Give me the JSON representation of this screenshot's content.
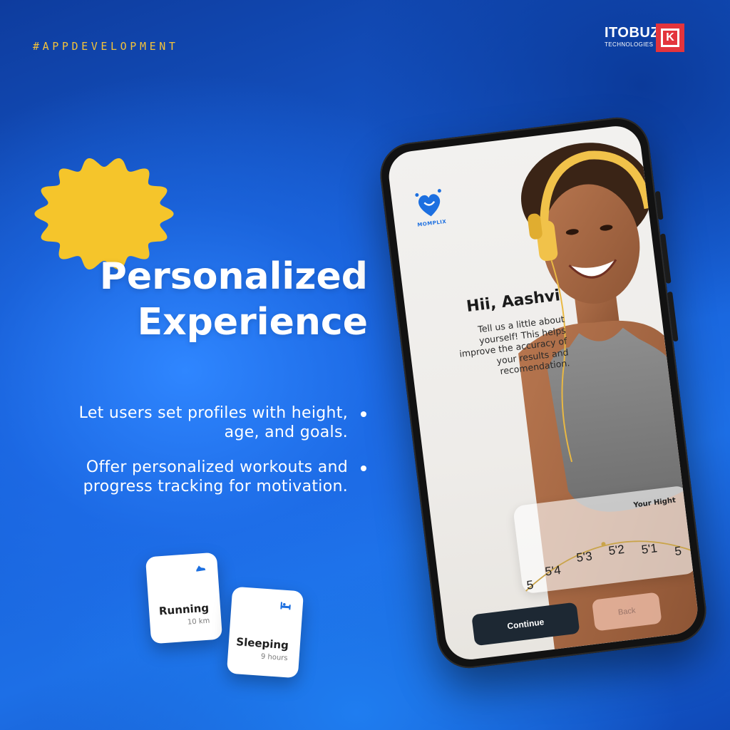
{
  "hashtag": "#APPDEVELOPMENT",
  "brand": {
    "name": "ITOBUZ",
    "sub": "TECHNOLOGIES",
    "mark": "K"
  },
  "headline": {
    "line1": "Personalized",
    "line2": "Experience"
  },
  "bullets": [
    "Let users set profiles with height, age, and goals.",
    "Offer personalized workouts and progress tracking for motivation."
  ],
  "tiles": [
    {
      "label": "Running",
      "value": "10 km",
      "icon": "running-shoe-icon"
    },
    {
      "label": "Sleeping",
      "value": "9 hours",
      "icon": "bed-icon"
    }
  ],
  "app": {
    "logo_text": "MOMPLIX",
    "greeting": "Hii, Aashvi",
    "intro": "Tell us a little about yourself! This helps improve the accuracy of your results and recomendation.",
    "height_card": {
      "title": "Your Hight",
      "ticks": [
        "5",
        "5'4",
        "5'3",
        "5'2",
        "5'1",
        "5"
      ]
    },
    "continue_label": "Continue",
    "back_label": "Back"
  },
  "colors": {
    "accent_yellow": "#f3c23a",
    "brand_red": "#e3343c",
    "app_blue": "#1c6fe0",
    "button_dark": "#1d2833"
  }
}
